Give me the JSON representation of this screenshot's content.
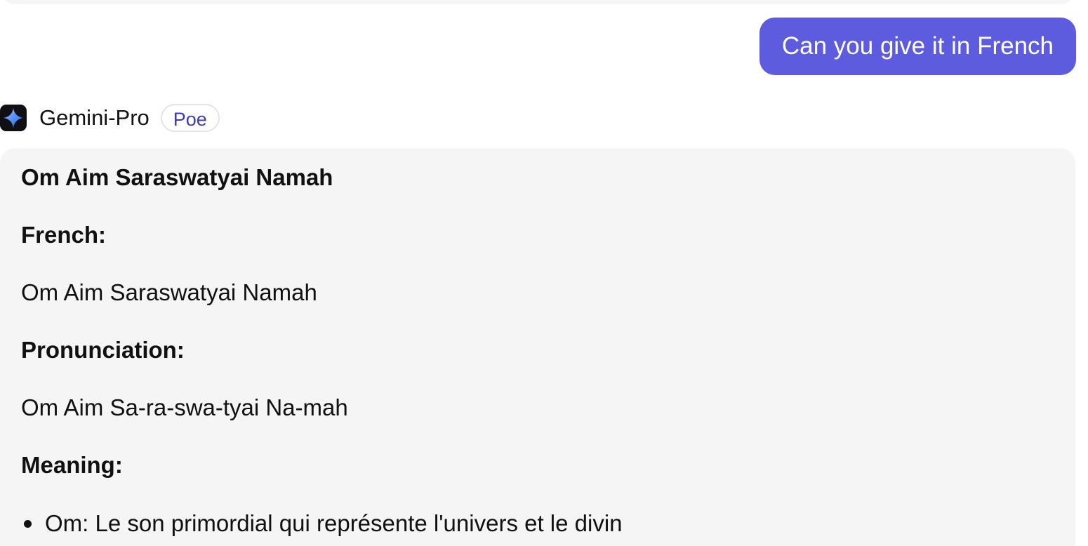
{
  "colors": {
    "user_bubble": "#5d5cde",
    "bot_bubble": "#f5f5f5",
    "badge_text": "#3b3bb8"
  },
  "user_message": {
    "text": "Can you give it in French"
  },
  "bot": {
    "icon": "gemini-sparkle-icon",
    "name": "Gemini-Pro",
    "badge": "Poe"
  },
  "bot_message": {
    "title": "Om Aim Saraswatyai Namah",
    "french_heading": "French:",
    "french_text": "Om Aim Saraswatyai Namah",
    "pronunciation_heading": "Pronunciation:",
    "pronunciation_text": "Om Aim Sa-ra-swa-tyai Na-mah",
    "meaning_heading": "Meaning:",
    "meaning_items": [
      "Om: Le son primordial qui représente l'univers et le divin"
    ]
  }
}
